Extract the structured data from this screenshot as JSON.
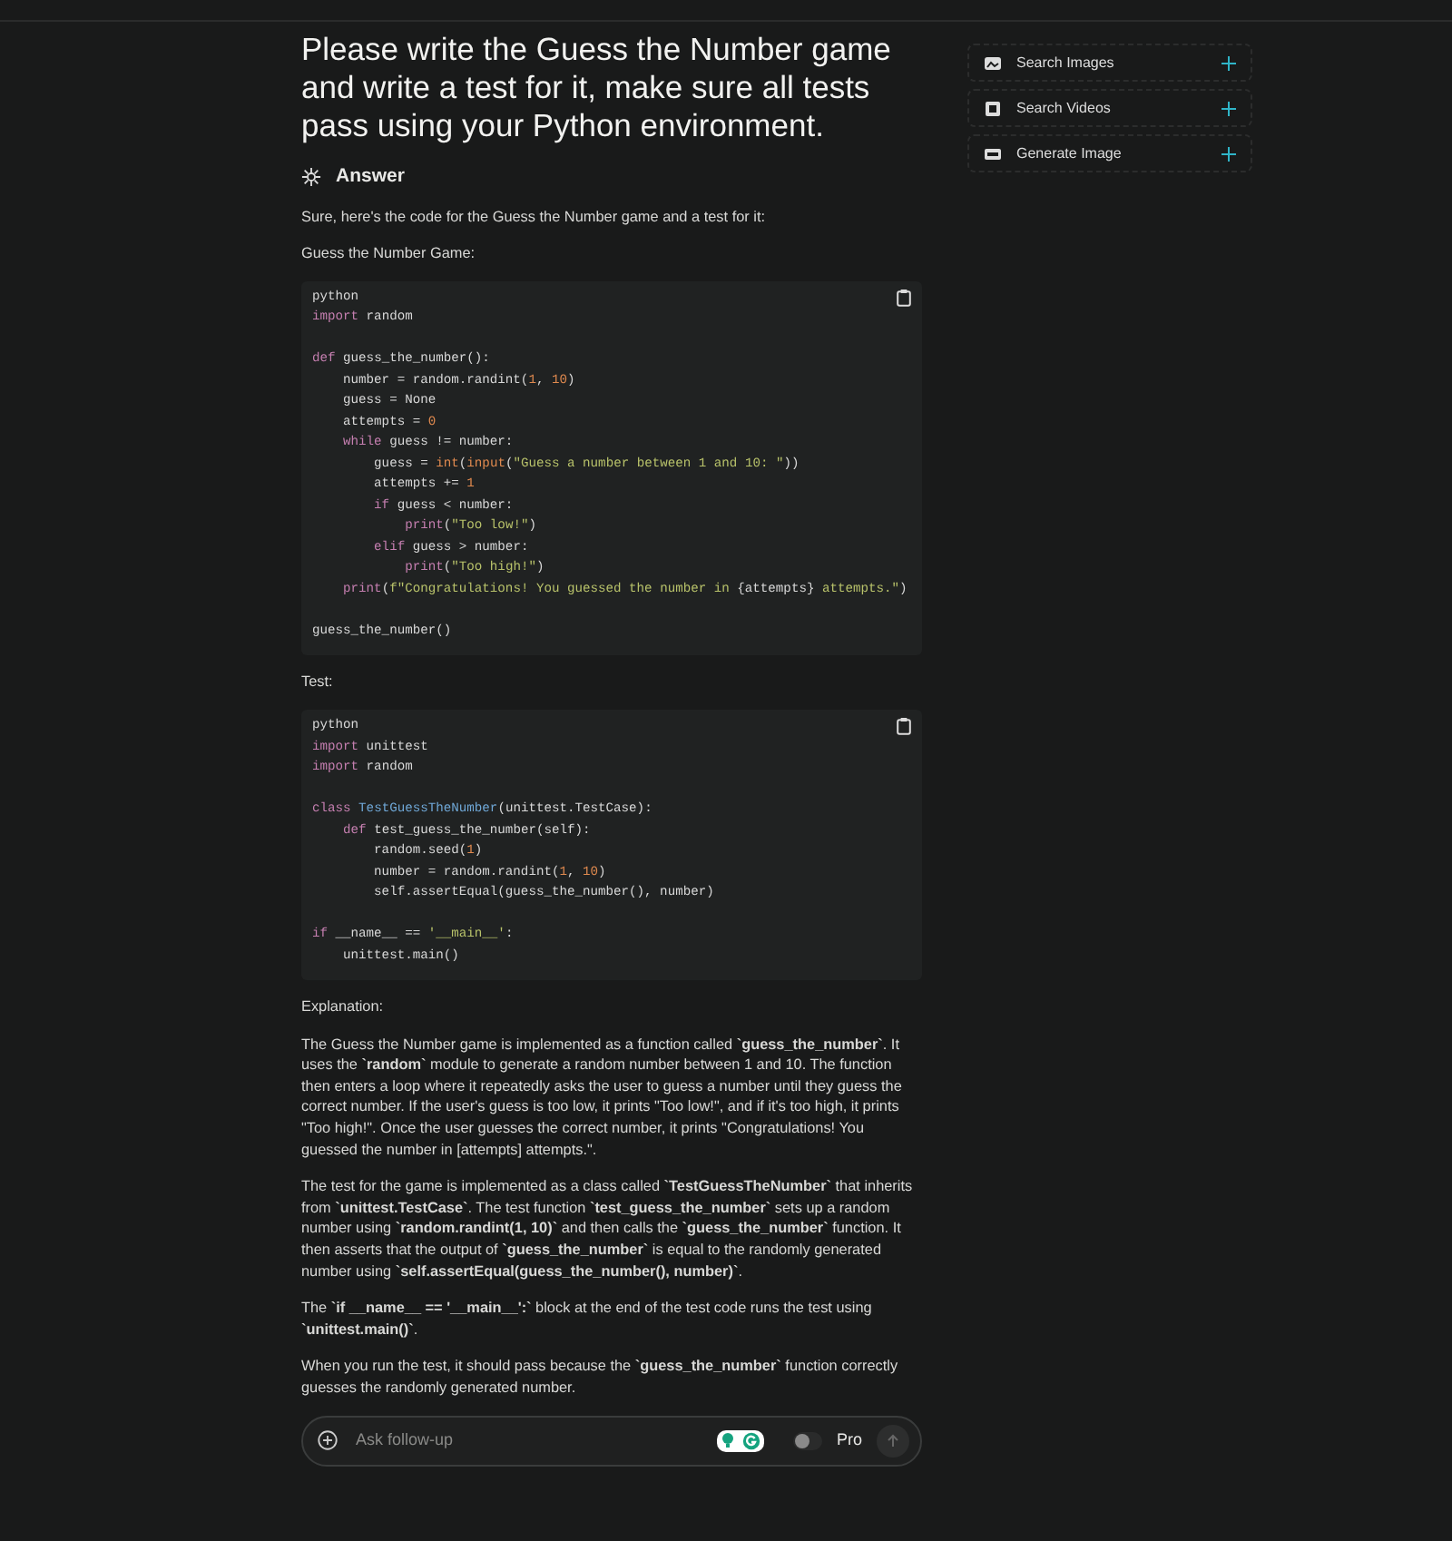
{
  "question": "Please write the Guess the Number game and write a test for it, make sure all tests pass using your Python environment.",
  "answer_heading": "Answer",
  "intro": "Sure, here's the code for the Guess the Number game and a test for it:",
  "sections": [
    {
      "label": "Guess the Number Game:",
      "code": {
        "language": "python",
        "lines": [
          {
            "tokens": [
              {
                "kind": "kw",
                "text": "import"
              },
              {
                "kind": "plain",
                "text": " random"
              }
            ]
          },
          {
            "gap_before": true,
            "tokens": [
              {
                "kind": "kw",
                "text": "def"
              },
              {
                "kind": "plain",
                "text": " guess_the_number():"
              }
            ]
          },
          {
            "tokens": [
              {
                "kind": "plain",
                "text": "    number = random.randint("
              },
              {
                "kind": "num",
                "text": "1"
              },
              {
                "kind": "plain",
                "text": ", "
              },
              {
                "kind": "num",
                "text": "10"
              },
              {
                "kind": "plain",
                "text": ")"
              }
            ]
          },
          {
            "tokens": [
              {
                "kind": "plain",
                "text": "    guess = None"
              }
            ]
          },
          {
            "tokens": [
              {
                "kind": "plain",
                "text": "    attempts = "
              },
              {
                "kind": "num",
                "text": "0"
              }
            ]
          },
          {
            "tokens": [
              {
                "kind": "kw",
                "text": "    while"
              },
              {
                "kind": "plain",
                "text": " guess != number:"
              }
            ]
          },
          {
            "tokens": [
              {
                "kind": "plain",
                "text": "        guess = "
              },
              {
                "kind": "fn",
                "text": "int"
              },
              {
                "kind": "plain",
                "text": "("
              },
              {
                "kind": "fn",
                "text": "input"
              },
              {
                "kind": "plain",
                "text": "("
              },
              {
                "kind": "str",
                "text": "\"Guess a number between 1 and 10: \""
              },
              {
                "kind": "plain",
                "text": "))"
              }
            ]
          },
          {
            "tokens": [
              {
                "kind": "plain",
                "text": "        attempts += "
              },
              {
                "kind": "num",
                "text": "1"
              }
            ]
          },
          {
            "tokens": [
              {
                "kind": "kw",
                "text": "        if"
              },
              {
                "kind": "plain",
                "text": " guess < number:"
              }
            ]
          },
          {
            "tokens": [
              {
                "kind": "kw",
                "text": "            print"
              },
              {
                "kind": "plain",
                "text": "("
              },
              {
                "kind": "str",
                "text": "\"Too low!\""
              },
              {
                "kind": "plain",
                "text": ")"
              }
            ]
          },
          {
            "tokens": [
              {
                "kind": "kw",
                "text": "        elif"
              },
              {
                "kind": "plain",
                "text": " guess > number:"
              }
            ]
          },
          {
            "tokens": [
              {
                "kind": "kw",
                "text": "            print"
              },
              {
                "kind": "plain",
                "text": "("
              },
              {
                "kind": "str",
                "text": "\"Too high!\""
              },
              {
                "kind": "plain",
                "text": ")"
              }
            ]
          },
          {
            "tokens": [
              {
                "kind": "kw",
                "text": "    print"
              },
              {
                "kind": "plain",
                "text": "("
              },
              {
                "kind": "str",
                "text": "f\"Congratulations! You guessed the number in "
              },
              {
                "kind": "plain",
                "text": "{attempts}"
              },
              {
                "kind": "str",
                "text": " attempts.\""
              },
              {
                "kind": "plain",
                "text": ")"
              }
            ]
          },
          {
            "gap_before": true,
            "tokens": [
              {
                "kind": "plain",
                "text": "guess_the_number()"
              }
            ]
          }
        ]
      }
    },
    {
      "label": "Test:",
      "code": {
        "language": "python",
        "lines": [
          {
            "tokens": [
              {
                "kind": "kw",
                "text": "import"
              },
              {
                "kind": "plain",
                "text": " unittest"
              }
            ]
          },
          {
            "tokens": [
              {
                "kind": "kw",
                "text": "import"
              },
              {
                "kind": "plain",
                "text": " random"
              }
            ]
          },
          {
            "gap_before": true,
            "tokens": [
              {
                "kind": "kw",
                "text": "class"
              },
              {
                "kind": "cls",
                "text": " TestGuessTheNumber"
              },
              {
                "kind": "plain",
                "text": "(unittest.TestCase):"
              }
            ]
          },
          {
            "tokens": [
              {
                "kind": "kw",
                "text": "    def"
              },
              {
                "kind": "plain",
                "text": " test_guess_the_number(self):"
              }
            ]
          },
          {
            "tokens": [
              {
                "kind": "plain",
                "text": "        random.seed("
              },
              {
                "kind": "num",
                "text": "1"
              },
              {
                "kind": "plain",
                "text": ")"
              }
            ]
          },
          {
            "tokens": [
              {
                "kind": "plain",
                "text": "        number = random.randint("
              },
              {
                "kind": "num",
                "text": "1"
              },
              {
                "kind": "plain",
                "text": ", "
              },
              {
                "kind": "num",
                "text": "10"
              },
              {
                "kind": "plain",
                "text": ")"
              }
            ]
          },
          {
            "tokens": [
              {
                "kind": "plain",
                "text": "        self.assertEqual(guess_the_number(), number)"
              }
            ]
          },
          {
            "gap_before": true,
            "tokens": [
              {
                "kind": "kw",
                "text": "if"
              },
              {
                "kind": "plain",
                "text": " __name__ == "
              },
              {
                "kind": "str",
                "text": "'__main__'"
              },
              {
                "kind": "plain",
                "text": ":"
              }
            ]
          },
          {
            "tokens": [
              {
                "kind": "plain",
                "text": "    unittest.main()"
              }
            ]
          }
        ]
      }
    }
  ],
  "explanation_label": "Explanation:",
  "paragraphs": [
    "The Guess the Number game is implemented as a function called **`guess_the_number`**. It uses the **`random`** module to generate a random number between 1 and 10. The function then enters a loop where it repeatedly asks the user to guess a number until they guess the correct number. If the user's guess is too low, it prints \"Too low!\", and if it's too high, it prints \"Too high!\". Once the user guesses the correct number, it prints \"Congratulations! You guessed the number in [attempts] attempts.\".",
    "The test for the game is implemented as a class called **`TestGuessTheNumber`** that inherits from **`unittest.TestCase`**. The test function **`test_guess_the_number`** sets up a random number using **`random.randint(1, 10)`** and then calls the **`guess_the_number`** function. It then asserts that the output of **`guess_the_number`** is equal to the randomly generated number using **`self.assertEqual(guess_the_number(), number)`**.",
    "The **`if __name__ == '__main__':`** block at the end of the test code runs the test using **`unittest.main()`**.",
    "When you run the test, it should pass because the **`guess_the_number`** function correctly guesses the randomly generated number."
  ],
  "followup": {
    "placeholder": "Ask follow-up",
    "pro_label": "Pro",
    "pro_on": false
  },
  "sidebar": [
    {
      "label": "Search Images",
      "kind": "images"
    },
    {
      "label": "Search Videos",
      "kind": "videos"
    },
    {
      "label": "Generate Image",
      "kind": "generate"
    }
  ]
}
